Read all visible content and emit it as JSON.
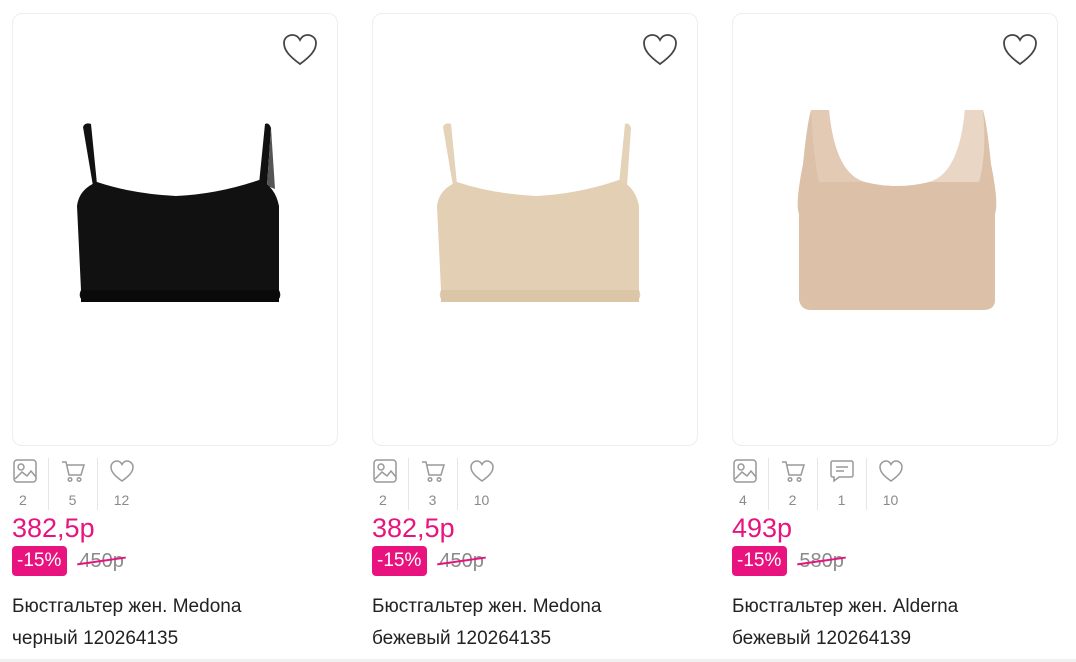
{
  "products": [
    {
      "price": "382,5р",
      "discount": "-15%",
      "old_price": "450р",
      "title_line1": "Бюстгальтер жен. Medona",
      "title_line2": "черный 120264135",
      "stats": {
        "photos": "2",
        "cart": "5",
        "likes": "12"
      },
      "color": "#111111"
    },
    {
      "price": "382,5р",
      "discount": "-15%",
      "old_price": "450р",
      "title_line1": "Бюстгальтер жен. Medona",
      "title_line2": "бежевый 120264135",
      "stats": {
        "photos": "2",
        "cart": "3",
        "likes": "10"
      },
      "color": "#e3cfb3"
    },
    {
      "price": "493р",
      "discount": "-15%",
      "old_price": "580р",
      "title_line1": "Бюстгальтер жен. Alderna",
      "title_line2": "бежевый 120264139",
      "stats": {
        "photos": "4",
        "cart": "2",
        "comments": "1",
        "likes": "10"
      },
      "color": "#dcc0a8"
    }
  ],
  "colors": {
    "accent": "#e8137f",
    "muted": "#8a8a8a",
    "border": "#eeeeee"
  },
  "icons": [
    "heart-icon",
    "photo-icon",
    "cart-icon",
    "comment-icon"
  ]
}
